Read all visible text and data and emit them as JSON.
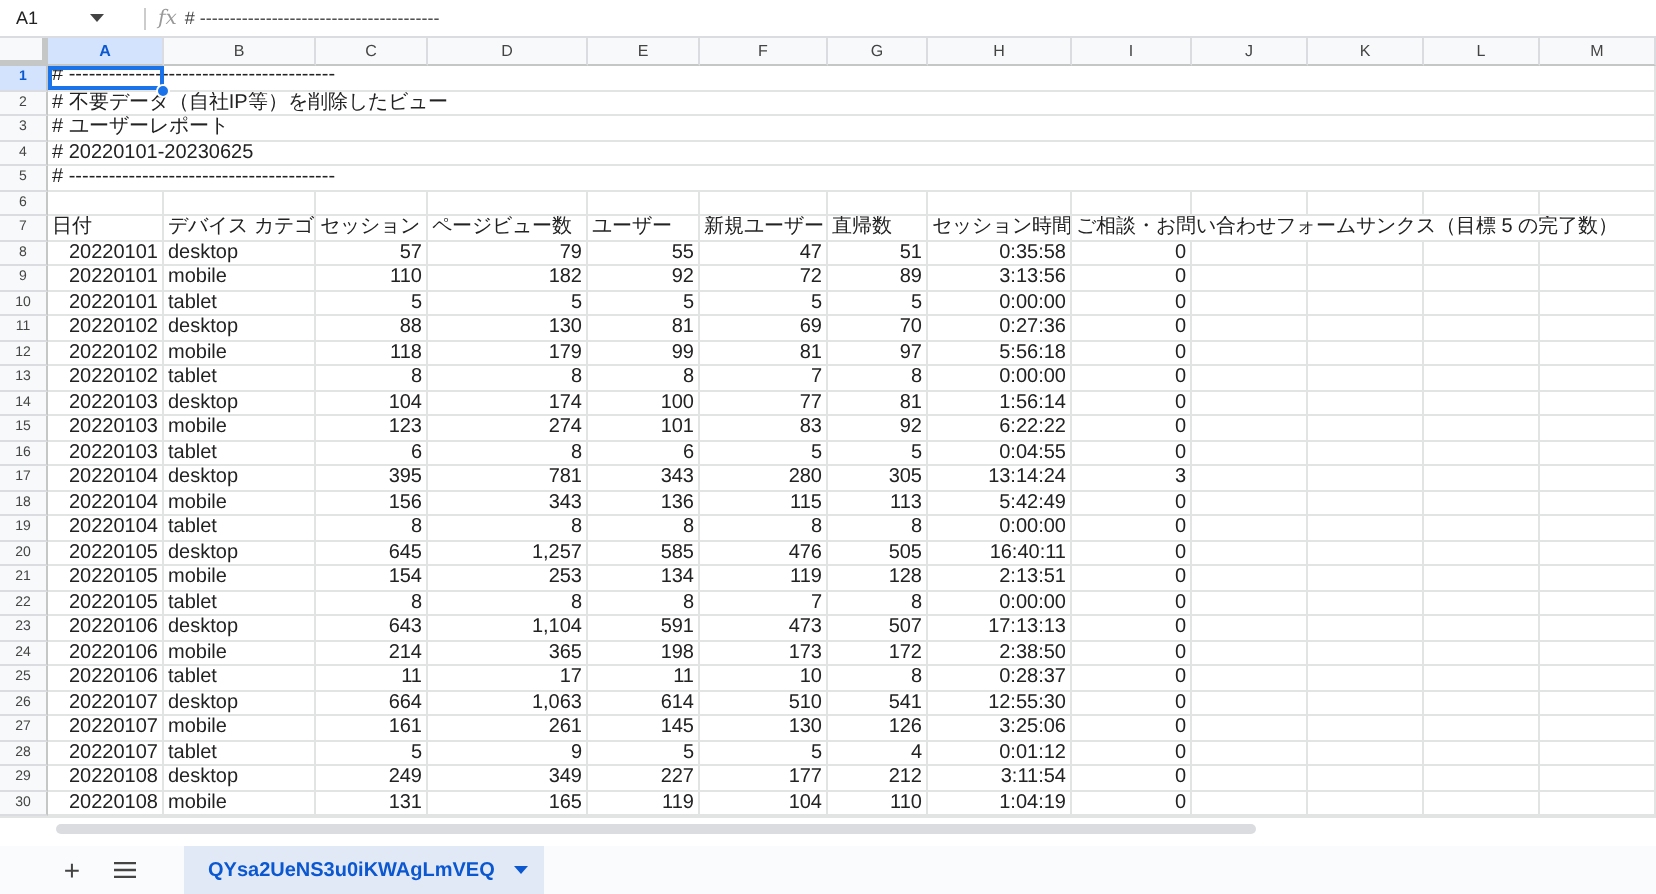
{
  "formula_bar": {
    "name_box": "A1",
    "fx": "fx",
    "formula": "# ----------------------------------------"
  },
  "columns": [
    {
      "letter": "A",
      "selected": true
    },
    {
      "letter": "B",
      "selected": false
    },
    {
      "letter": "C",
      "selected": false
    },
    {
      "letter": "D",
      "selected": false
    },
    {
      "letter": "E",
      "selected": false
    },
    {
      "letter": "F",
      "selected": false
    },
    {
      "letter": "G",
      "selected": false
    },
    {
      "letter": "H",
      "selected": false
    },
    {
      "letter": "I",
      "selected": false
    },
    {
      "letter": "J",
      "selected": false
    },
    {
      "letter": "K",
      "selected": false
    },
    {
      "letter": "L",
      "selected": false
    },
    {
      "letter": "M",
      "selected": false
    }
  ],
  "rows": [
    {
      "number": "1",
      "selected": true,
      "kind": "note",
      "cells": [
        "# ----------------------------------------"
      ]
    },
    {
      "number": "2",
      "selected": false,
      "kind": "note",
      "cells": [
        "# 不要データ（自社IP等）を削除したビュー"
      ]
    },
    {
      "number": "3",
      "selected": false,
      "kind": "note",
      "cells": [
        "# ユーザーレポート"
      ]
    },
    {
      "number": "4",
      "selected": false,
      "kind": "note",
      "cells": [
        "# 20220101-20230625"
      ]
    },
    {
      "number": "5",
      "selected": false,
      "kind": "note",
      "cells": [
        "# ----------------------------------------"
      ]
    },
    {
      "number": "6",
      "selected": false
    },
    {
      "number": "7",
      "selected": false,
      "kind": "header",
      "cells": [
        "日付",
        "デバイス カテゴ",
        "セッション",
        "ページビュー数",
        "ユーザー",
        "新規ユーザー",
        "直帰数",
        "セッション時間",
        "ご相談・お問い合わせフォームサンクス（目標 5 の完了数）"
      ]
    },
    {
      "number": "8",
      "selected": false,
      "kind": "data",
      "cells": [
        "20220101",
        "desktop",
        "57",
        "79",
        "55",
        "47",
        "51",
        "0:35:58",
        "0"
      ]
    },
    {
      "number": "9",
      "selected": false,
      "kind": "data",
      "cells": [
        "20220101",
        "mobile",
        "110",
        "182",
        "92",
        "72",
        "89",
        "3:13:56",
        "0"
      ]
    },
    {
      "number": "10",
      "selected": false,
      "kind": "data",
      "cells": [
        "20220101",
        "tablet",
        "5",
        "5",
        "5",
        "5",
        "5",
        "0:00:00",
        "0"
      ]
    },
    {
      "number": "11",
      "selected": false,
      "kind": "data",
      "cells": [
        "20220102",
        "desktop",
        "88",
        "130",
        "81",
        "69",
        "70",
        "0:27:36",
        "0"
      ]
    },
    {
      "number": "12",
      "selected": false,
      "kind": "data",
      "cells": [
        "20220102",
        "mobile",
        "118",
        "179",
        "99",
        "81",
        "97",
        "5:56:18",
        "0"
      ]
    },
    {
      "number": "13",
      "selected": false,
      "kind": "data",
      "cells": [
        "20220102",
        "tablet",
        "8",
        "8",
        "8",
        "7",
        "8",
        "0:00:00",
        "0"
      ]
    },
    {
      "number": "14",
      "selected": false,
      "kind": "data",
      "cells": [
        "20220103",
        "desktop",
        "104",
        "174",
        "100",
        "77",
        "81",
        "1:56:14",
        "0"
      ]
    },
    {
      "number": "15",
      "selected": false,
      "kind": "data",
      "cells": [
        "20220103",
        "mobile",
        "123",
        "274",
        "101",
        "83",
        "92",
        "6:22:22",
        "0"
      ]
    },
    {
      "number": "16",
      "selected": false,
      "kind": "data",
      "cells": [
        "20220103",
        "tablet",
        "6",
        "8",
        "6",
        "5",
        "5",
        "0:04:55",
        "0"
      ]
    },
    {
      "number": "17",
      "selected": false,
      "kind": "data",
      "cells": [
        "20220104",
        "desktop",
        "395",
        "781",
        "343",
        "280",
        "305",
        "13:14:24",
        "3"
      ]
    },
    {
      "number": "18",
      "selected": false,
      "kind": "data",
      "cells": [
        "20220104",
        "mobile",
        "156",
        "343",
        "136",
        "115",
        "113",
        "5:42:49",
        "0"
      ]
    },
    {
      "number": "19",
      "selected": false,
      "kind": "data",
      "cells": [
        "20220104",
        "tablet",
        "8",
        "8",
        "8",
        "8",
        "8",
        "0:00:00",
        "0"
      ]
    },
    {
      "number": "20",
      "selected": false,
      "kind": "data",
      "cells": [
        "20220105",
        "desktop",
        "645",
        "1,257",
        "585",
        "476",
        "505",
        "16:40:11",
        "0"
      ]
    },
    {
      "number": "21",
      "selected": false,
      "kind": "data",
      "cells": [
        "20220105",
        "mobile",
        "154",
        "253",
        "134",
        "119",
        "128",
        "2:13:51",
        "0"
      ]
    },
    {
      "number": "22",
      "selected": false,
      "kind": "data",
      "cells": [
        "20220105",
        "tablet",
        "8",
        "8",
        "8",
        "7",
        "8",
        "0:00:00",
        "0"
      ]
    },
    {
      "number": "23",
      "selected": false,
      "kind": "data",
      "cells": [
        "20220106",
        "desktop",
        "643",
        "1,104",
        "591",
        "473",
        "507",
        "17:13:13",
        "0"
      ]
    },
    {
      "number": "24",
      "selected": false,
      "kind": "data",
      "cells": [
        "20220106",
        "mobile",
        "214",
        "365",
        "198",
        "173",
        "172",
        "2:38:50",
        "0"
      ]
    },
    {
      "number": "25",
      "selected": false,
      "kind": "data",
      "cells": [
        "20220106",
        "tablet",
        "11",
        "17",
        "11",
        "10",
        "8",
        "0:28:37",
        "0"
      ]
    },
    {
      "number": "26",
      "selected": false,
      "kind": "data",
      "cells": [
        "20220107",
        "desktop",
        "664",
        "1,063",
        "614",
        "510",
        "541",
        "12:55:30",
        "0"
      ]
    },
    {
      "number": "27",
      "selected": false,
      "kind": "data",
      "cells": [
        "20220107",
        "mobile",
        "161",
        "261",
        "145",
        "130",
        "126",
        "3:25:06",
        "0"
      ]
    },
    {
      "number": "28",
      "selected": false,
      "kind": "data",
      "cells": [
        "20220107",
        "tablet",
        "5",
        "9",
        "5",
        "5",
        "4",
        "0:01:12",
        "0"
      ]
    },
    {
      "number": "29",
      "selected": false,
      "kind": "data",
      "cells": [
        "20220108",
        "desktop",
        "249",
        "349",
        "227",
        "177",
        "212",
        "3:11:54",
        "0"
      ]
    },
    {
      "number": "30",
      "selected": false,
      "kind": "data",
      "cells": [
        "20220108",
        "mobile",
        "131",
        "165",
        "119",
        "104",
        "110",
        "1:04:19",
        "0"
      ]
    }
  ],
  "sheet_bar": {
    "add_button": "+",
    "tabs": [
      {
        "label": "QYsa2UeNS3u0iKWAgLmVEQ",
        "selected": true
      }
    ]
  }
}
